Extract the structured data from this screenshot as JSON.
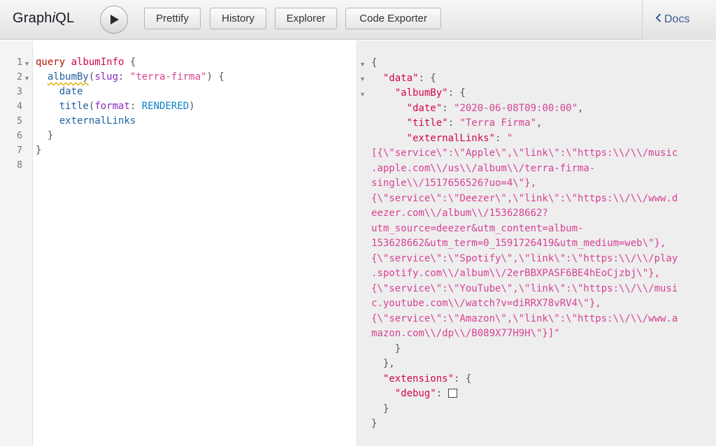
{
  "toolbar": {
    "logo_pre": "Graph",
    "logo_i": "i",
    "logo_post": "QL",
    "buttons": [
      "Prettify",
      "History",
      "Explorer",
      "Code Exporter"
    ],
    "docs_label": "Docs"
  },
  "query_editor": {
    "line_numbers": [
      "1",
      "2",
      "3",
      "4",
      "5",
      "6",
      "7",
      "8"
    ],
    "lines": [
      "query albumInfo {",
      "  albumBy(slug: \"terra-firma\") {",
      "    date",
      "    title(format: RENDERED)",
      "    externalLinks",
      "  }",
      "}",
      ""
    ],
    "tokens": {
      "query_keyword": "query",
      "operation_name": "albumInfo",
      "field_album": "albumBy",
      "arg_slug": "slug",
      "slug_value": "\"terra-firma\"",
      "field_date": "date",
      "field_title": "title",
      "arg_format": "format",
      "format_value": "RENDERED",
      "field_links": "externalLinks"
    }
  },
  "result_viewer": {
    "key_data": "\"data\"",
    "key_albumBy": "\"albumBy\"",
    "key_date": "\"date\"",
    "val_date": "\"2020-06-08T09:00:00\"",
    "key_title": "\"title\"",
    "val_title": "\"Terra Firma\"",
    "key_links": "\"externalLinks\"",
    "val_links_open": "\"",
    "links_lines": [
      "[{\\\"service\\\":\\\"Apple\\\",\\\"link\\\":\\\"https:\\\\/\\\\/music",
      ".apple.com\\\\/us\\\\/album\\\\/terra-firma-",
      "single\\\\/1517656526?uo=4\\\"},",
      "{\\\"service\\\":\\\"Deezer\\\",\\\"link\\\":\\\"https:\\\\/\\\\/www.d",
      "eezer.com\\\\/album\\\\/153628662?",
      "utm_source=deezer&utm_content=album-",
      "153628662&utm_term=0_1591726419&utm_medium=web\\\"},",
      "{\\\"service\\\":\\\"Spotify\\\",\\\"link\\\":\\\"https:\\\\/\\\\/play",
      ".spotify.com\\\\/album\\\\/2erBBXPASF6BE4hEoCjzbj\\\"},",
      "{\\\"service\\\":\\\"YouTube\\\",\\\"link\\\":\\\"https:\\\\/\\\\/musi",
      "c.youtube.com\\\\/watch?v=diRRX78vRV4\\\"},",
      "{\\\"service\\\":\\\"Amazon\\\",\\\"link\\\":\\\"https:\\\\/\\\\/www.a",
      "mazon.com\\\\/dp\\\\/B089X77H9H\\\"}]\""
    ],
    "key_extensions": "\"extensions\"",
    "key_debug": "\"debug\""
  },
  "icons": {
    "run": "play-icon",
    "docs": "chevron-left-icon",
    "fold": "fold-arrow-icon",
    "debug": "checkbox-icon"
  },
  "colors": {
    "keyword": "#b11a04",
    "definition": "#d2054e",
    "property": "#1f61a0",
    "attribute": "#8b2bb9",
    "string": "#d64292",
    "enum": "#0b7fc7",
    "link": "#3b5998"
  }
}
